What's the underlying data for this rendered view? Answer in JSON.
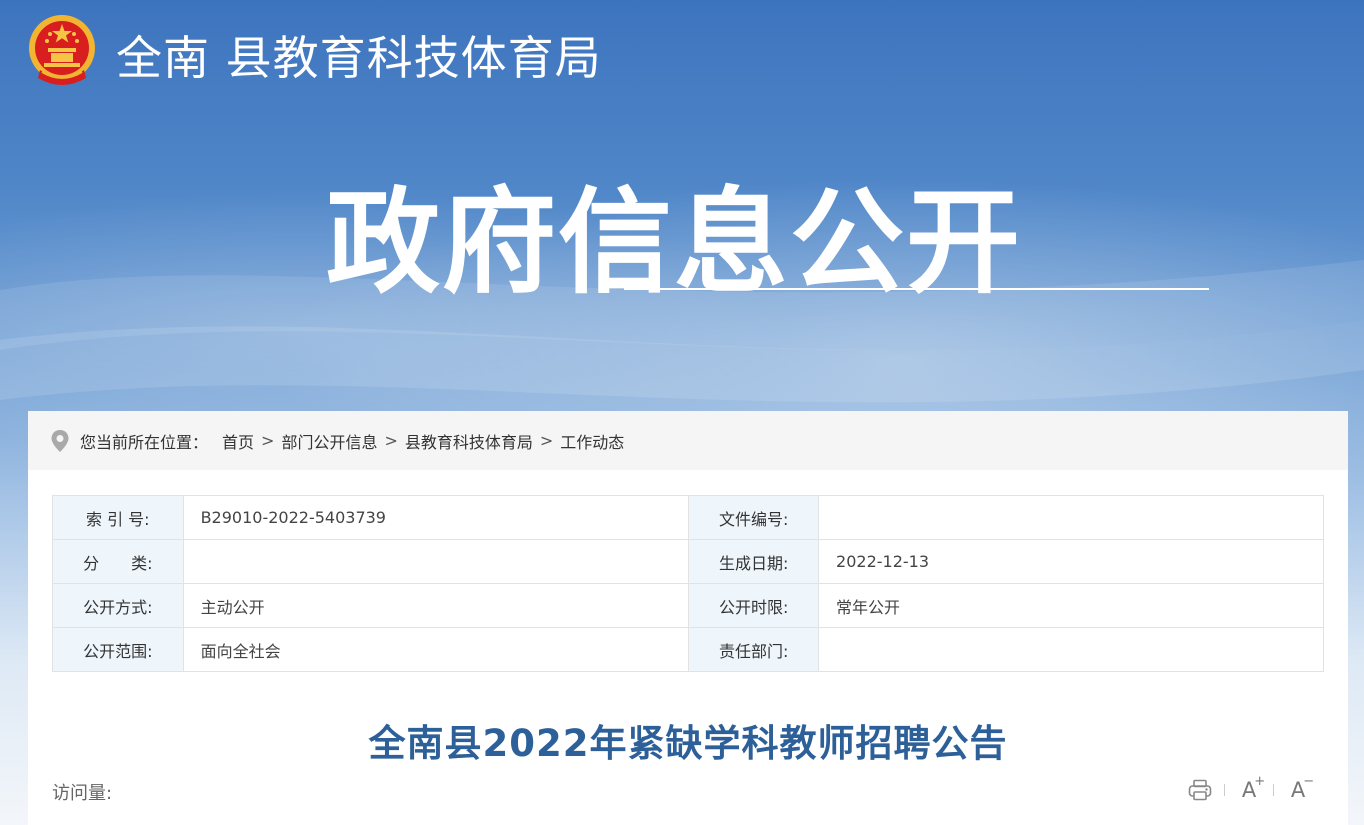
{
  "header": {
    "site_title": "全南 县教育科技体育局",
    "hero_title": "政府信息公开"
  },
  "breadcrumb": {
    "prefix": "您当前所在位置：",
    "items": [
      "首页",
      "部门公开信息",
      "县教育科技体育局",
      "工作动态"
    ],
    "separator": ">"
  },
  "meta": {
    "rows": [
      {
        "k1": "索 引 号:",
        "v1": "B29010-2022-5403739",
        "k2": "文件编号:",
        "v2": ""
      },
      {
        "k1": "分　　类:",
        "v1": "",
        "k2": "生成日期:",
        "v2": "2022-12-13"
      },
      {
        "k1": "公开方式:",
        "v1": "主动公开",
        "k2": "公开时限:",
        "v2": "常年公开"
      },
      {
        "k1": "公开范围:",
        "v1": "面向全社会",
        "k2": "责任部门:",
        "v2": ""
      }
    ]
  },
  "article": {
    "title": "全南县2022年紧缺学科教师招聘公告",
    "views_label": "访问量:"
  },
  "tools": {
    "font_increase_label": "A",
    "font_increase_mark": "+",
    "font_decrease_label": "A",
    "font_decrease_mark": "−"
  },
  "icons": [
    "emblem-icon",
    "location-pin-icon",
    "print-icon",
    "font-increase-icon",
    "font-decrease-icon"
  ],
  "colors": {
    "accent": "#2d5f99",
    "banner_top": "#3d74be",
    "label_bg": "#eef5fb"
  }
}
